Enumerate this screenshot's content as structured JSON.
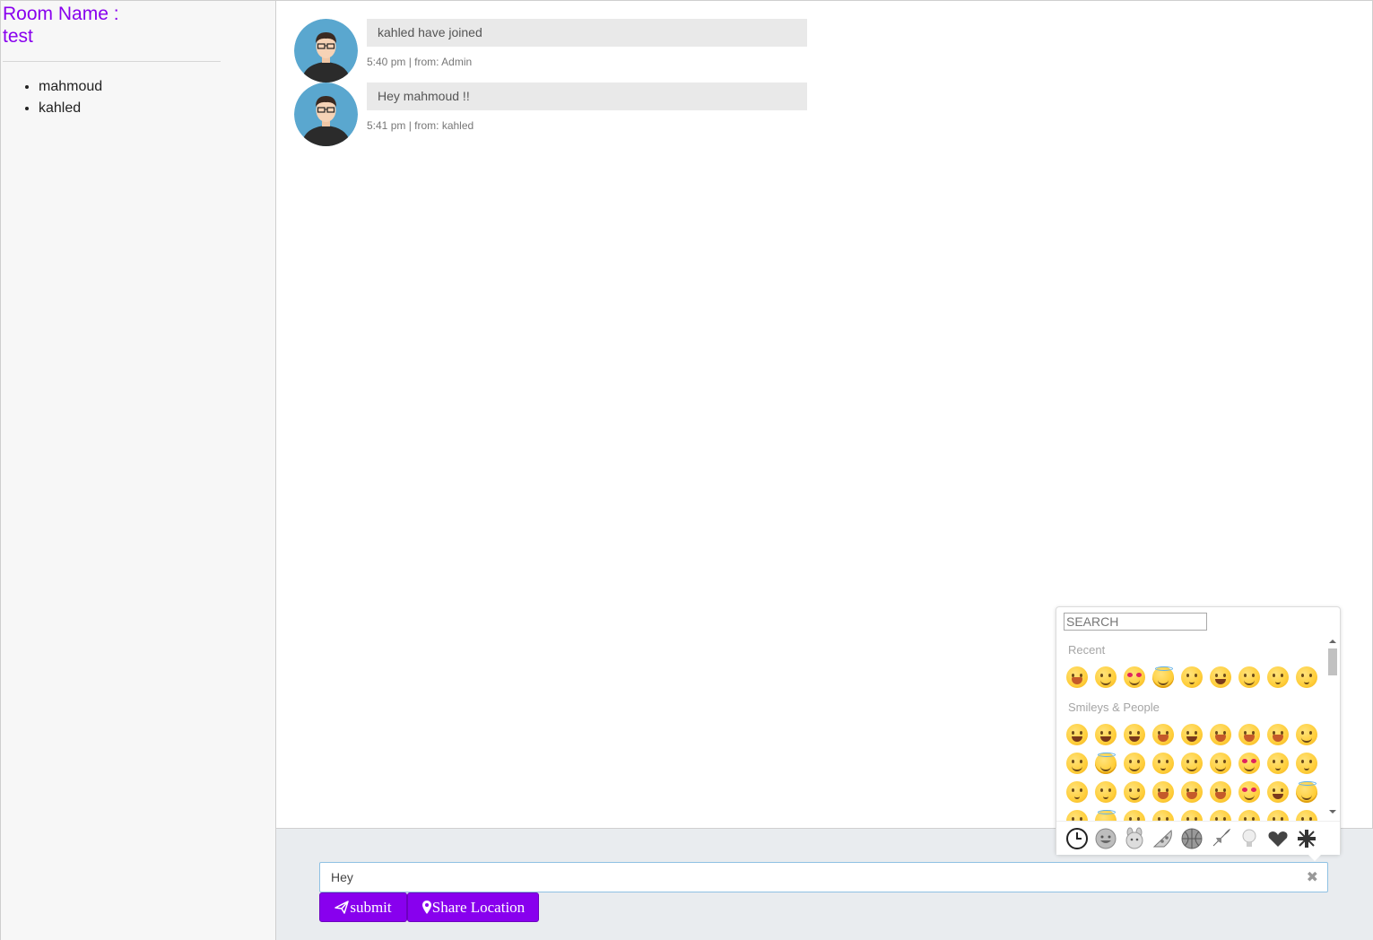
{
  "room": {
    "title_line1": "Room Name :",
    "title_line2": "test"
  },
  "users": [
    "mahmoud",
    "kahled"
  ],
  "messages": [
    {
      "text": "kahled have joined",
      "meta": "5:40 pm | from: Admin",
      "avatar": "user-avatar-icon"
    },
    {
      "text": "Hey mahmoud !!",
      "meta": "5:41 pm | from: kahled",
      "avatar": "user-avatar-icon"
    }
  ],
  "compose": {
    "value": "Hey",
    "clear_icon": "close-icon",
    "submit_label": "submit",
    "submit_icon": "paper-plane-icon",
    "location_label": "Share Location",
    "location_icon": "map-marker-icon"
  },
  "emoji_picker": {
    "search_placeholder": "SEARCH",
    "categories": [
      {
        "title": "Recent"
      },
      {
        "title": "Smileys & People"
      }
    ],
    "tabs": [
      "clock-icon",
      "smiley-icon",
      "animal-icon",
      "food-icon",
      "sports-icon",
      "travel-icon",
      "lightbulb-icon",
      "heart-icon",
      "flag-icon"
    ]
  },
  "colors": {
    "accent": "#8800ee",
    "bubble": "#e9e9e9",
    "footer_bg": "#e9ecef",
    "avatar_bg": "#5aa7cf"
  }
}
